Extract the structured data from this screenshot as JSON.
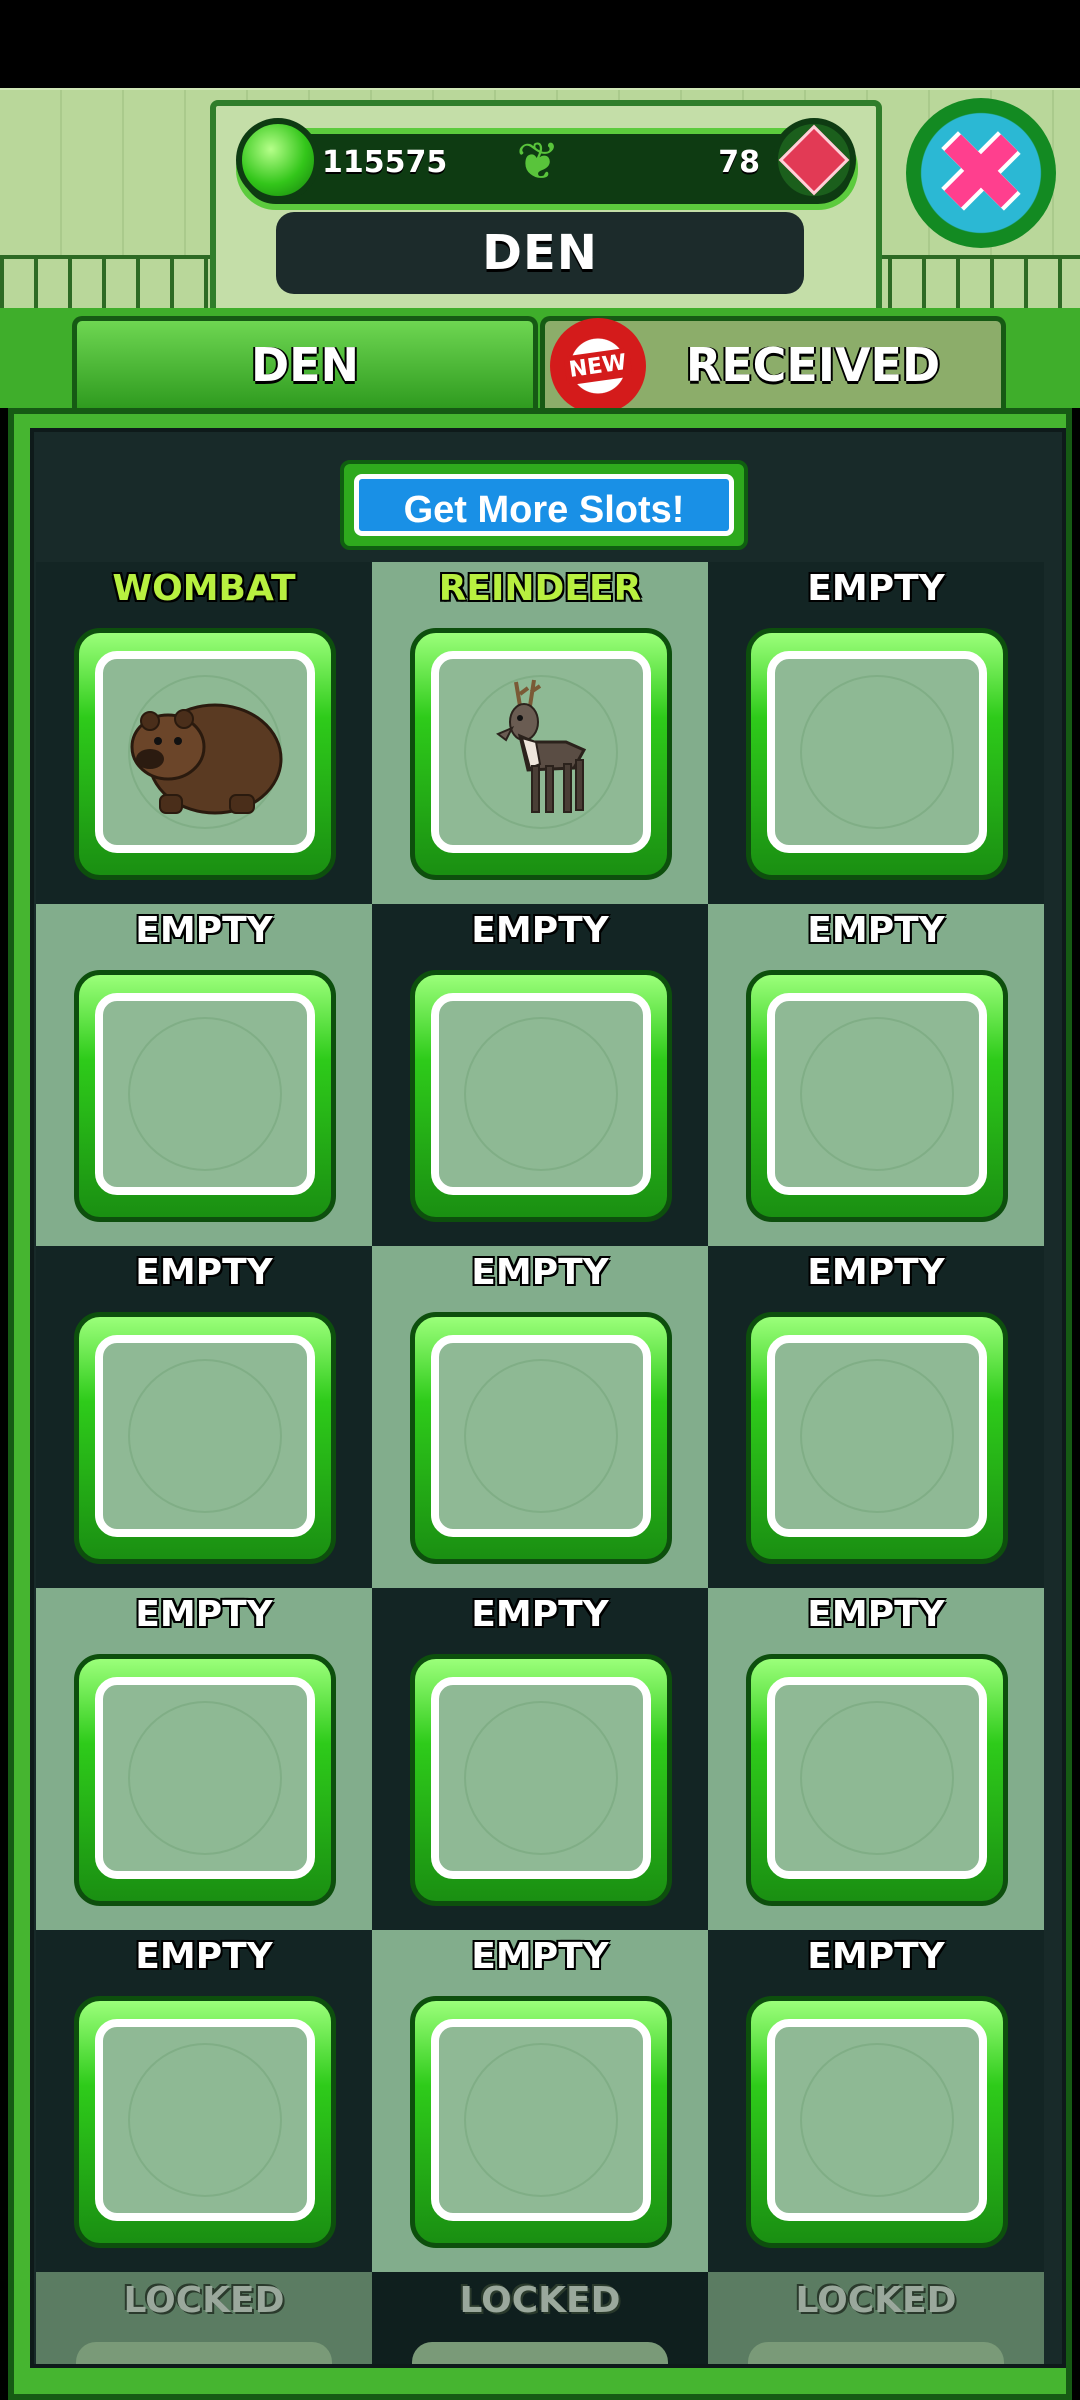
{
  "header": {
    "coins": "115575",
    "gems": "78",
    "title": "DEN",
    "close_icon": "close-x-icon"
  },
  "tabs": [
    {
      "label": "DEN",
      "active": true
    },
    {
      "label": "RECEIVED",
      "active": false,
      "badge": "NEW"
    }
  ],
  "get_slots_label": "Get More Slots!",
  "slots": [
    {
      "label": "WOMBAT",
      "content": "wombat"
    },
    {
      "label": "REINDEER",
      "content": "reindeer"
    },
    {
      "label": "EMPTY",
      "content": ""
    },
    {
      "label": "EMPTY",
      "content": ""
    },
    {
      "label": "EMPTY",
      "content": ""
    },
    {
      "label": "EMPTY",
      "content": ""
    },
    {
      "label": "EMPTY",
      "content": ""
    },
    {
      "label": "EMPTY",
      "content": ""
    },
    {
      "label": "EMPTY",
      "content": ""
    },
    {
      "label": "EMPTY",
      "content": ""
    },
    {
      "label": "EMPTY",
      "content": ""
    },
    {
      "label": "EMPTY",
      "content": ""
    },
    {
      "label": "EMPTY",
      "content": ""
    },
    {
      "label": "EMPTY",
      "content": ""
    },
    {
      "label": "EMPTY",
      "content": ""
    }
  ],
  "locked": [
    "LOCKED",
    "LOCKED",
    "LOCKED"
  ],
  "colors": {
    "accent_green": "#46b530",
    "dark_cell": "#132524",
    "light_cell": "#82ad8c",
    "button_blue": "#1990e6",
    "close_pink": "#ff3f8e"
  }
}
